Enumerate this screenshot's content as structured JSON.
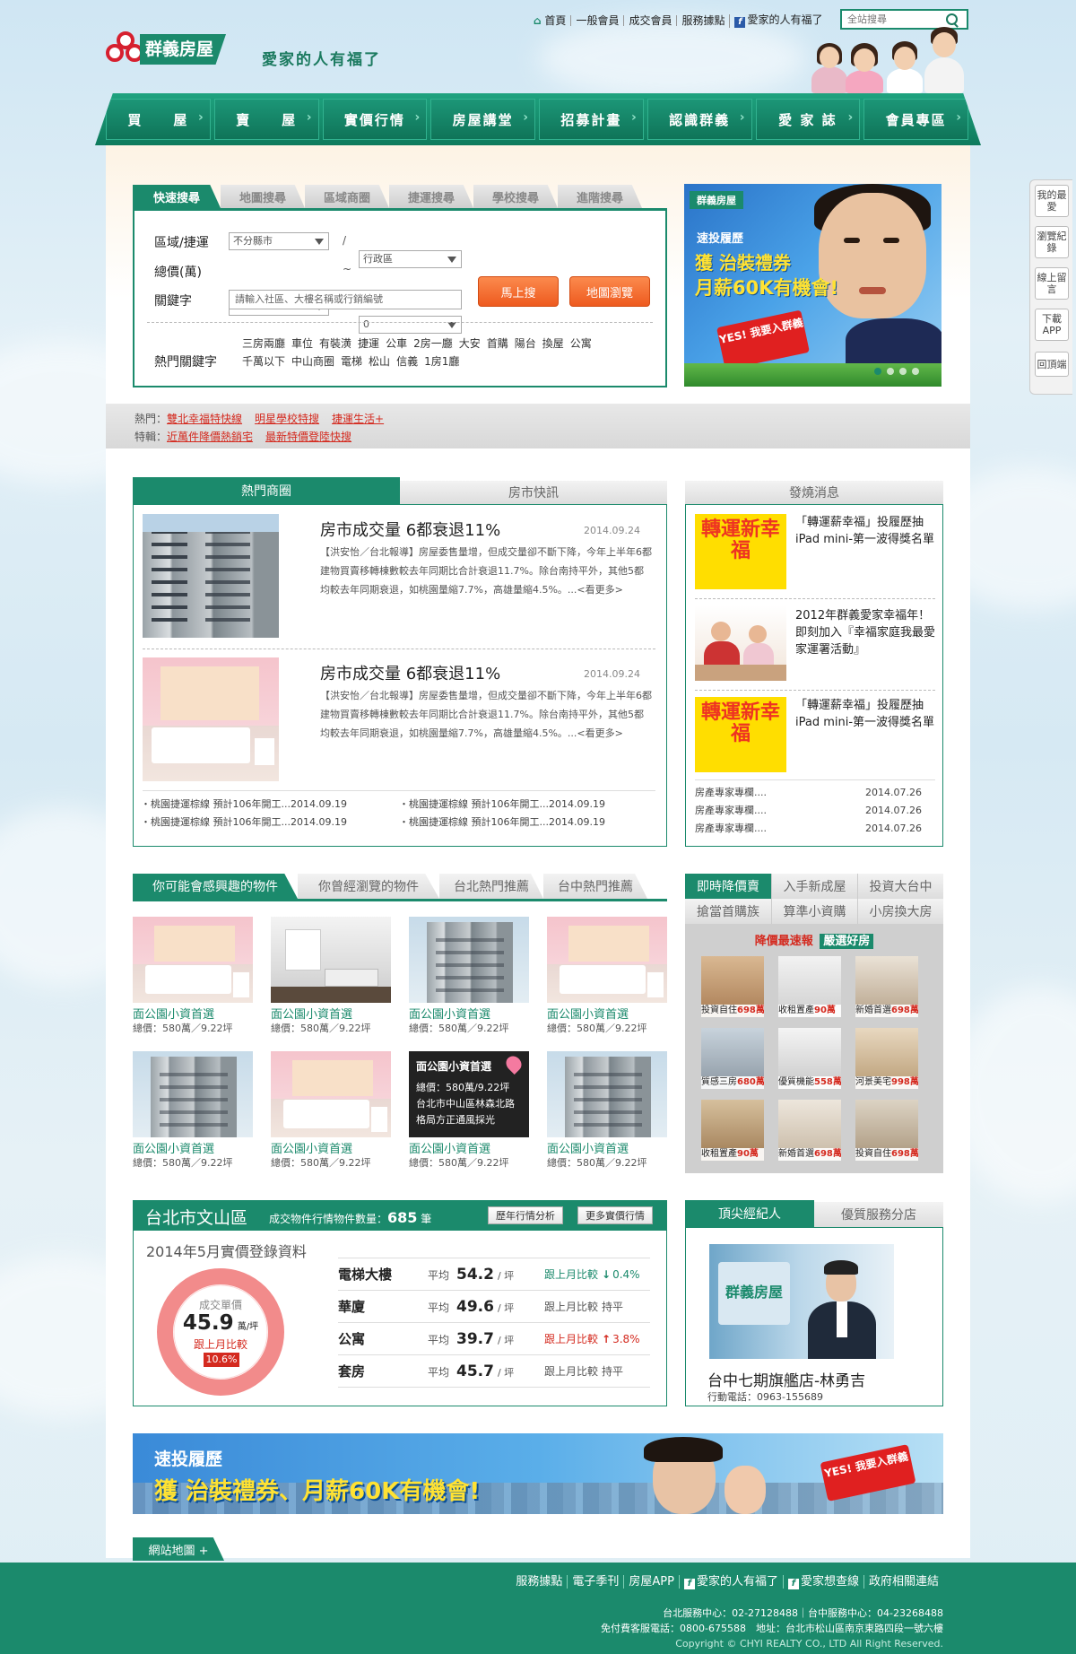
{
  "top": {
    "links": [
      "首頁",
      "一般會員",
      "成交會員",
      "服務據點",
      "愛家的人有福了"
    ],
    "search_placeholder": "全站搜尋"
  },
  "brand": {
    "name": "群義房屋",
    "slogan": "愛家的人有福了"
  },
  "nav": [
    "買　　屋",
    "賣　　屋",
    "實價行情",
    "房屋講堂",
    "招募計畫",
    "認識群義",
    "愛 家 誌",
    "會員專區"
  ],
  "quick": {
    "tabs": [
      "快速搜尋",
      "地圖搜尋",
      "區域商圈",
      "捷運搜尋",
      "學校搜尋",
      "進階搜尋"
    ],
    "area_label": "區域/捷運",
    "area_value": "不分縣市",
    "district_value": "行政區",
    "price_label": "總價(萬)",
    "price_from": "0",
    "price_to": "0",
    "keyword_label": "關鍵字",
    "keyword_placeholder": "請輸入社區、大樓名稱或行銷編號",
    "btn_search": "馬上搜",
    "btn_map": "地圖瀏覽",
    "hot_label": "熱門關鍵字",
    "hot_line1": [
      "三房兩廳",
      "車位",
      "有裝潢",
      "捷運",
      "公車",
      "2房一廳",
      "大安",
      "首購",
      "陽台",
      "換屋",
      "公寓"
    ],
    "hot_line2": [
      "千萬以下",
      "中山商圈",
      "電梯",
      "松山",
      "信義",
      "1房1廳"
    ]
  },
  "topbanner": {
    "logo": "群義房屋",
    "line1": "速投履歷",
    "line2": "獲 治裝禮券",
    "line3": "月薪60K有機會!",
    "yes": "YES! 我要入群義"
  },
  "hotstrip": {
    "label1": "熱門：",
    "items1": [
      "雙北幸福特快線",
      "明星學校特搜",
      "捷運生活+"
    ],
    "label2": "特輯：",
    "items2": [
      "近萬件降價熱銷宅",
      "最新特價登陸快搜"
    ]
  },
  "newsbox": {
    "tabs": [
      "熱門商圈",
      "房市快訊"
    ],
    "articles": [
      {
        "title": "房市成交量 6都衰退11%",
        "date": "2014.09.24",
        "body": "【洪安怡／台北報導】房屋委售量增，但成交量卻不斷下降，今年上半年6都建物買賣移轉棟數較去年同期比合計衰退11.7%。除台南持平外，其他5都均較去年同期衰退，如桃園量縮7.7%，高雄量縮4.5%。...<看更多>"
      },
      {
        "title": "房市成交量 6都衰退11%",
        "date": "2014.09.24",
        "body": "【洪安怡／台北報導】房屋委售量增，但成交量卻不斷下降，今年上半年6都建物買賣移轉棟數較去年同期比合計衰退11.7%。除台南持平外，其他5都均較去年同期衰退，如桃園量縮7.7%，高雄量縮4.5%。...<看更多>"
      }
    ],
    "list": [
      "・桃園捷運棕線 預計106年開工...2014.09.19",
      "・桃園捷運棕線 預計106年開工...2014.09.19",
      "・桃園捷運棕線 預計106年開工...2014.09.19",
      "・桃園捷運棕線 預計106年開工...2014.09.19"
    ]
  },
  "sidenews": {
    "title": "發燒消息",
    "fortune": "轉運新幸福",
    "items": [
      "「轉運薪幸福」投履歷抽iPad mini-第一波得獎名單",
      "2012年群義愛家幸福年！即刻加入『幸福家庭我最愛家運署活動』",
      "「轉運薪幸福」投履歷抽iPad mini-第一波得獎名單"
    ],
    "list": [
      {
        "t": "房產專家專欄....",
        "d": "2014.07.26"
      },
      {
        "t": "房產專家專欄....",
        "d": "2014.07.26"
      },
      {
        "t": "房產專家專欄....",
        "d": "2014.07.26"
      }
    ]
  },
  "props": {
    "tabs": [
      "你可能會感興趣的物件",
      "你曾經瀏覽的物件",
      "台北熱門推薦",
      "台中熱門推薦"
    ],
    "name": "面公園小資首選",
    "price": "總價：580萬／9.22坪",
    "overlay_title": "面公園小資首選",
    "overlay_lines": [
      "總價：580萬/9.22坪",
      "台北市中山區林森北路",
      "格局方正通風採光"
    ]
  },
  "pricecut": {
    "tabs1": [
      "即時降價賣",
      "入手新成屋",
      "投資大台中"
    ],
    "tabs2": [
      "搶當首購族",
      "算準小資購",
      "小房換大房"
    ],
    "heading": "降價最速報",
    "heading_tag": "嚴選好房",
    "tiles": [
      {
        "l": "投資自住",
        "p": "698萬"
      },
      {
        "l": "收租置產",
        "p": "90萬"
      },
      {
        "l": "新婚首選",
        "p": "698萬"
      },
      {
        "l": "質感三房",
        "p": "680萬"
      },
      {
        "l": "優質機能",
        "p": "558萬"
      },
      {
        "l": "河景美宅",
        "p": "998萬"
      },
      {
        "l": "收租置產",
        "p": "90萬"
      },
      {
        "l": "新婚首選",
        "p": "698萬"
      },
      {
        "l": "投資自住",
        "p": "698萬"
      }
    ]
  },
  "stats": {
    "district": "台北市文山區",
    "count_label": "成交物件行情物件數量：",
    "count": "685",
    "count_unit": "筆",
    "btn1": "歷年行情分析",
    "btn2": "更多實價行情",
    "period": "2014年5月實價登錄資料",
    "ring_label": "成交單價",
    "ring_value": "45.9",
    "ring_unit": "萬/坪",
    "ring_compare": "跟上月比較",
    "ring_change": "10.6%",
    "rows": [
      {
        "n": "電梯大樓",
        "avg": "54.2",
        "cmp": "跟上月比較",
        "chg": "0.4%",
        "dir": "down"
      },
      {
        "n": "華廈",
        "avg": "49.6",
        "cmp": "跟上月比較",
        "chg": "持平",
        "dir": "flat"
      },
      {
        "n": "公寓",
        "avg": "39.7",
        "cmp": "跟上月比較",
        "chg": "3.8%",
        "dir": "up"
      },
      {
        "n": "套房",
        "avg": "45.7",
        "cmp": "跟上月比較",
        "chg": "持平",
        "dir": "flat"
      }
    ],
    "avg_prefix": "平均",
    "avg_unit": "/ 坪"
  },
  "agent": {
    "tabs": [
      "頂尖經紀人",
      "優質服務分店"
    ],
    "sign": "群義房屋",
    "name": "台中七期旗艦店-林勇吉",
    "phone": "行動電話：0963-155689"
  },
  "bottombanner": {
    "line1": "速投履歷",
    "line2": "獲 治裝禮券、月薪60K有機會!",
    "yes": "YES! 我要入群義"
  },
  "footer": {
    "sitemap": "網站地圖 +",
    "links": [
      "服務據點",
      "電子季刊",
      "房屋APP",
      "愛家的人有福了",
      "愛家想查線",
      "政府相關連結"
    ],
    "line1": "台北服務中心：02-27128488｜台中服務中心：04-23268488",
    "line2": "免付費客服電話：0800-675588　地址：台北市松山區南京東路四段一號六樓",
    "line3": "Copyright © CHYI REALTY CO., LTD All Right Reserved."
  },
  "floatbar": [
    "我的最愛",
    "瀏覽紀錄",
    "線上留言",
    "下載APP",
    "回頂端"
  ]
}
